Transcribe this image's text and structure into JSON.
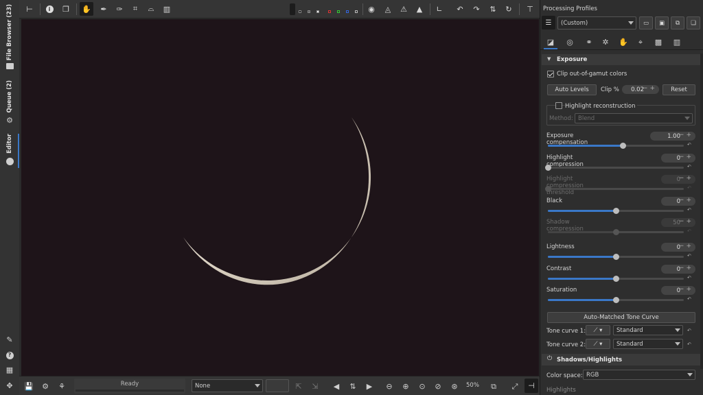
{
  "left_tabs": {
    "file_browser": "File Browser (23)",
    "queue": "Queue (2)",
    "editor": "Editor"
  },
  "status": {
    "ready": "Ready",
    "profile_combo": "None",
    "zoom": "50%"
  },
  "profiles": {
    "header": "Processing Profiles",
    "current": "(Custom)"
  },
  "exposure": {
    "section_title": "Exposure",
    "clip_gamut_label": "Clip out-of-gamut colors",
    "auto_levels": "Auto Levels",
    "clip_label": "Clip %",
    "clip_value": "0.02",
    "reset": "Reset",
    "highlight_recon_label": "Highlight reconstruction",
    "method_label": "Method:",
    "method_value": "Blend",
    "sliders": [
      {
        "label": "Exposure compensation",
        "value": "1.00",
        "fraction": 0.55,
        "enabled": true
      },
      {
        "label": "Highlight compression",
        "value": "0",
        "fraction": 0.0,
        "enabled": true
      },
      {
        "label": "Highlight compression threshold",
        "value": "0",
        "fraction": 0.0,
        "enabled": false
      },
      {
        "label": "Black",
        "value": "0",
        "fraction": 0.5,
        "enabled": true
      },
      {
        "label": "Shadow compression",
        "value": "50",
        "fraction": 0.5,
        "enabled": false
      },
      {
        "label": "Lightness",
        "value": "0",
        "fraction": 0.5,
        "enabled": true
      },
      {
        "label": "Contrast",
        "value": "0",
        "fraction": 0.5,
        "enabled": true
      },
      {
        "label": "Saturation",
        "value": "0",
        "fraction": 0.5,
        "enabled": true
      }
    ],
    "auto_tone_curve": "Auto-Matched Tone Curve",
    "tone_curve_1_label": "Tone curve 1:",
    "tone_curve_1_value": "Standard",
    "tone_curve_2_label": "Tone curve 2:",
    "tone_curve_2_value": "Standard"
  },
  "shadows_highlights": {
    "section_title": "Shadows/Highlights",
    "color_space_label": "Color space:",
    "color_space_value": "RGB",
    "next_label": "Highlights"
  },
  "colors": {
    "accent": "#3a78c8",
    "panel": "#2e2e2e",
    "image_bg": "#1e1419"
  }
}
